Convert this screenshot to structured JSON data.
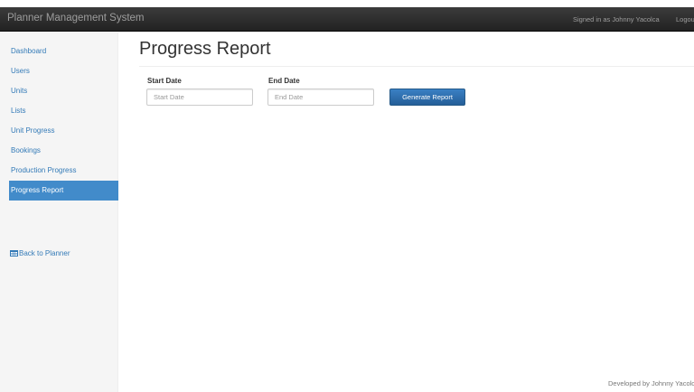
{
  "navbar": {
    "brand": "Planner Management System",
    "signed_in": "Signed in as Johnny Yacolca",
    "logout": "Logout"
  },
  "sidebar": {
    "items": [
      {
        "label": "Dashboard"
      },
      {
        "label": "Users"
      },
      {
        "label": "Units"
      },
      {
        "label": "Lists"
      },
      {
        "label": "Unit Progress"
      },
      {
        "label": "Bookings"
      },
      {
        "label": "Production Progress"
      },
      {
        "label": "Progress Report",
        "active": true
      }
    ],
    "back_link": "Back to Planner",
    "back_icon": "calendar-icon"
  },
  "main": {
    "title": "Progress Report",
    "start_date": {
      "label": "Start Date",
      "placeholder": "Start Date",
      "value": ""
    },
    "end_date": {
      "label": "End Date",
      "placeholder": "End Date",
      "value": ""
    },
    "generate_button": "Generate Report"
  },
  "footer": {
    "text": "Developed by Johnny Yacolca"
  },
  "colors": {
    "navbar": "#222222",
    "navbar_text": "#9d9d9d",
    "link": "#337ab7",
    "active_bg": "#428bca",
    "button": "#2e6da4"
  }
}
